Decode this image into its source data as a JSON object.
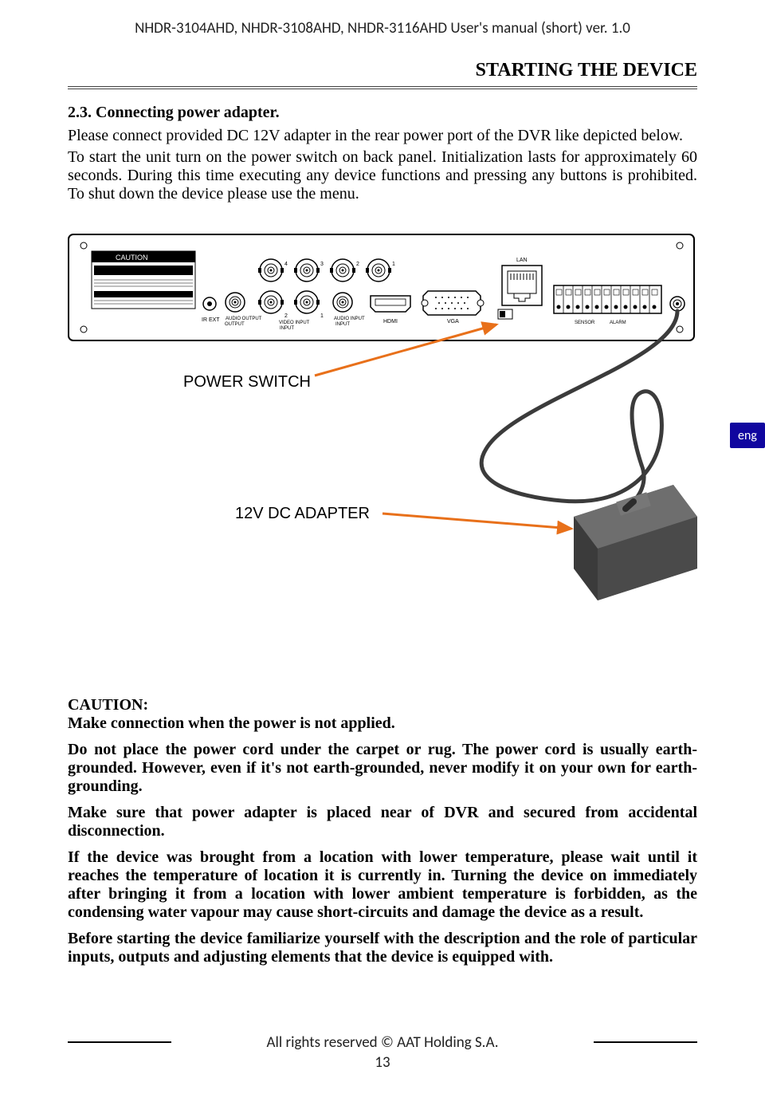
{
  "header_title": "NHDR-3104AHD, NHDR-3108AHD, NHDR-3116AHD User's manual (short) ver. 1.0",
  "section_title": "STARTING THE DEVICE",
  "subsection_title": "2.3. Connecting power adapter.",
  "intro_line": "Please connect provided DC 12V adapter in the rear power port of the DVR like depicted below.",
  "init_para": "To start the unit turn on the power switch on back panel. Initialization lasts for approximately 60 seconds. During this time executing any device functions and pressing any buttons is prohibited. To shut down the device please use the menu.",
  "lang_tab": "eng",
  "diagram": {
    "power_switch_label": "POWER SWITCH",
    "adapter_label": "12V DC ADAPTER",
    "rear_ports": {
      "caution_box": "CAUTION",
      "ir_ext": "IR EXT",
      "audio_output": "AUDIO OUTPUT",
      "video_input": "VIDEO INPUT",
      "audio_input": "AUDIO INPUT",
      "hdmi": "HDMI",
      "vga": "VGA",
      "lan": "LAN",
      "sensor": "SENSOR",
      "alarm": "ALARM"
    }
  },
  "caution": {
    "heading": "CAUTION:",
    "p1": "Make connection when the power is not applied.",
    "p2": "Do not place the power cord under the carpet or rug. The power cord is usually earth-grounded. However, even if it's not earth-grounded, never modify it on your own for earth-grounding.",
    "p3": "Make sure that power adapter is placed near of DVR and secured from accidental disconnection.",
    "p4": "If the device was brought from a location with lower temperature, please wait until it reaches the temperature of location it is currently in. Turning the device on immediately after bringing it from a location with lower ambient temperature is forbidden, as the condensing water vapour may cause short-circuits and damage the device as a result.",
    "p5": "Before starting the device familiarize yourself with the description and the role of particular inputs, outputs and adjusting elements that the device is equipped with."
  },
  "footer_text": "All rights reserved © AAT Holding S.A.",
  "page_number": "13"
}
